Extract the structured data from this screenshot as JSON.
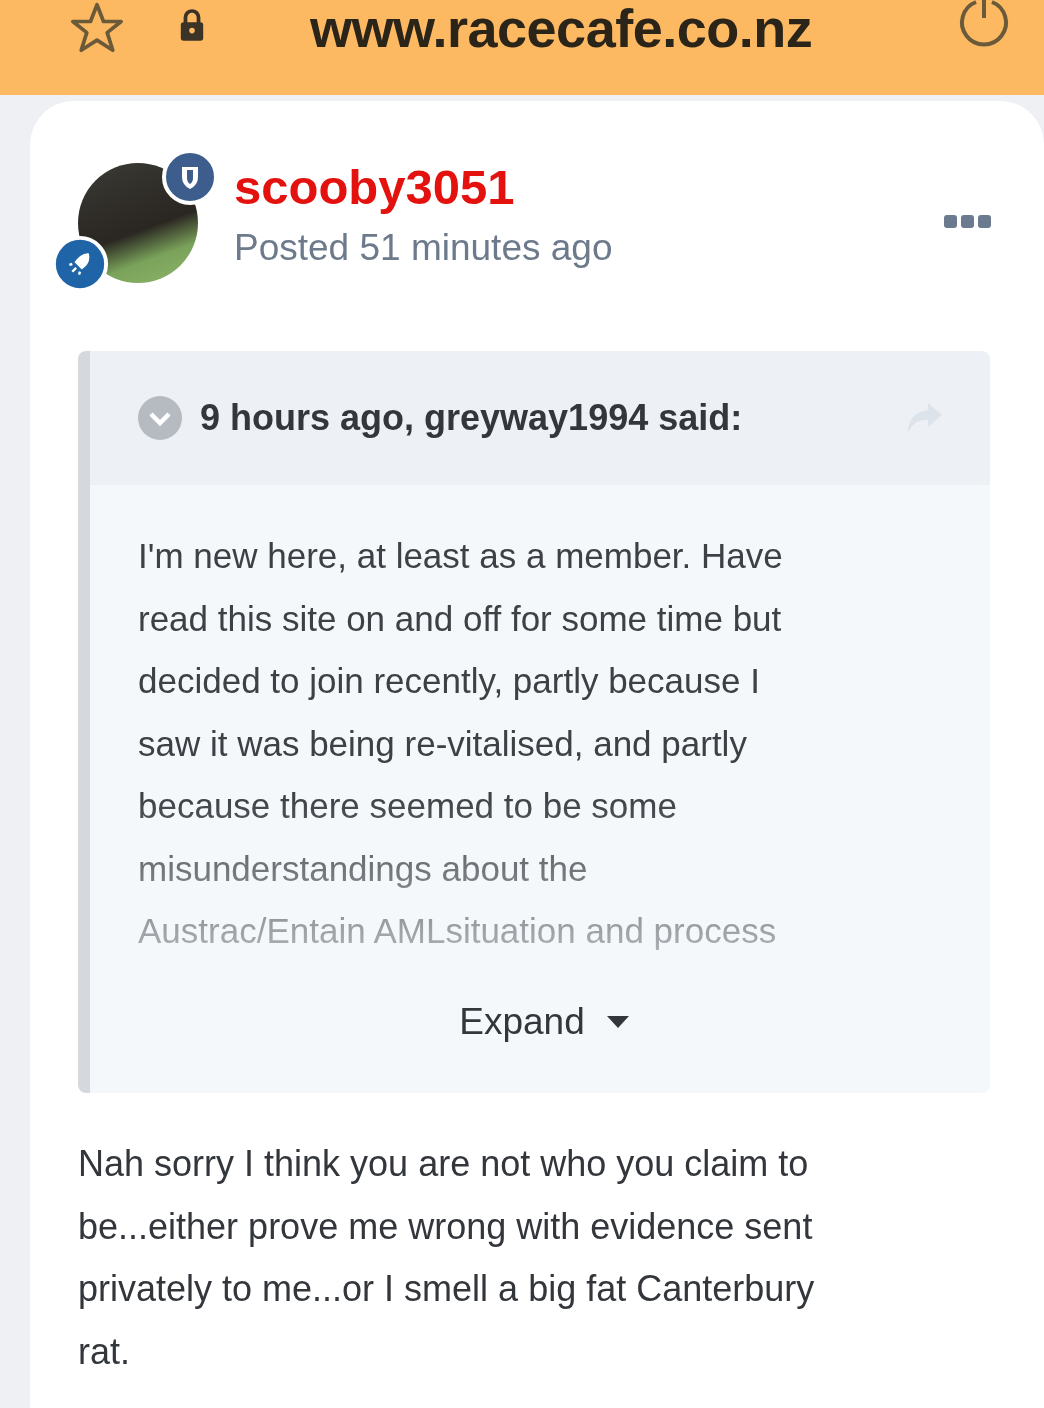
{
  "browser_bar": {
    "url": "www.racecafe.co.nz"
  },
  "post": {
    "author": "scooby3051",
    "posted": "Posted 51 minutes ago",
    "quote": {
      "header": "9 hours ago, greyway1994 said:",
      "lines": [
        "I'm new here, at least as a member. Have",
        "read this site on and off for some time but",
        "decided to join recently, partly because I",
        "saw it was being re-vitalised, and partly",
        "because there seemed to be some",
        "misunderstandings about the",
        "Austrac/Entain AMLsituation and process"
      ],
      "expand": "Expand"
    },
    "body_lines": [
      "Nah sorry I think you are not who you claim to",
      "be...either prove me wrong with evidence sent",
      "privately to me...or I smell a big fat Canterbury",
      "rat."
    ]
  }
}
